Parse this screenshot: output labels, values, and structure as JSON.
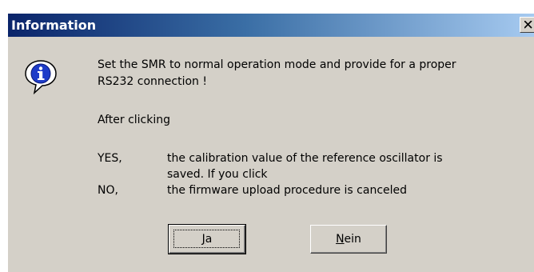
{
  "window": {
    "title": "Information",
    "close_icon": "close-x-icon",
    "info_icon": "information-icon"
  },
  "message": {
    "line1": "Set the SMR to normal operation mode and provide for a proper",
    "line2": "RS232 connection !",
    "after_clicking": "After clicking",
    "yes_key": "YES,",
    "yes_text_line1": "the calibration value of the reference oscillator is",
    "yes_text_line2": "saved. If you click",
    "no_key": "NO,",
    "no_text": "the firmware upload procedure is canceled"
  },
  "buttons": {
    "ja": {
      "mnemonic": "J",
      "rest": "a"
    },
    "nein": {
      "mnemonic": "N",
      "rest": "ein"
    }
  },
  "colors": {
    "title_start": "#0a246a",
    "title_end": "#a6caf0",
    "dialog_bg": "#d4d0c8"
  }
}
